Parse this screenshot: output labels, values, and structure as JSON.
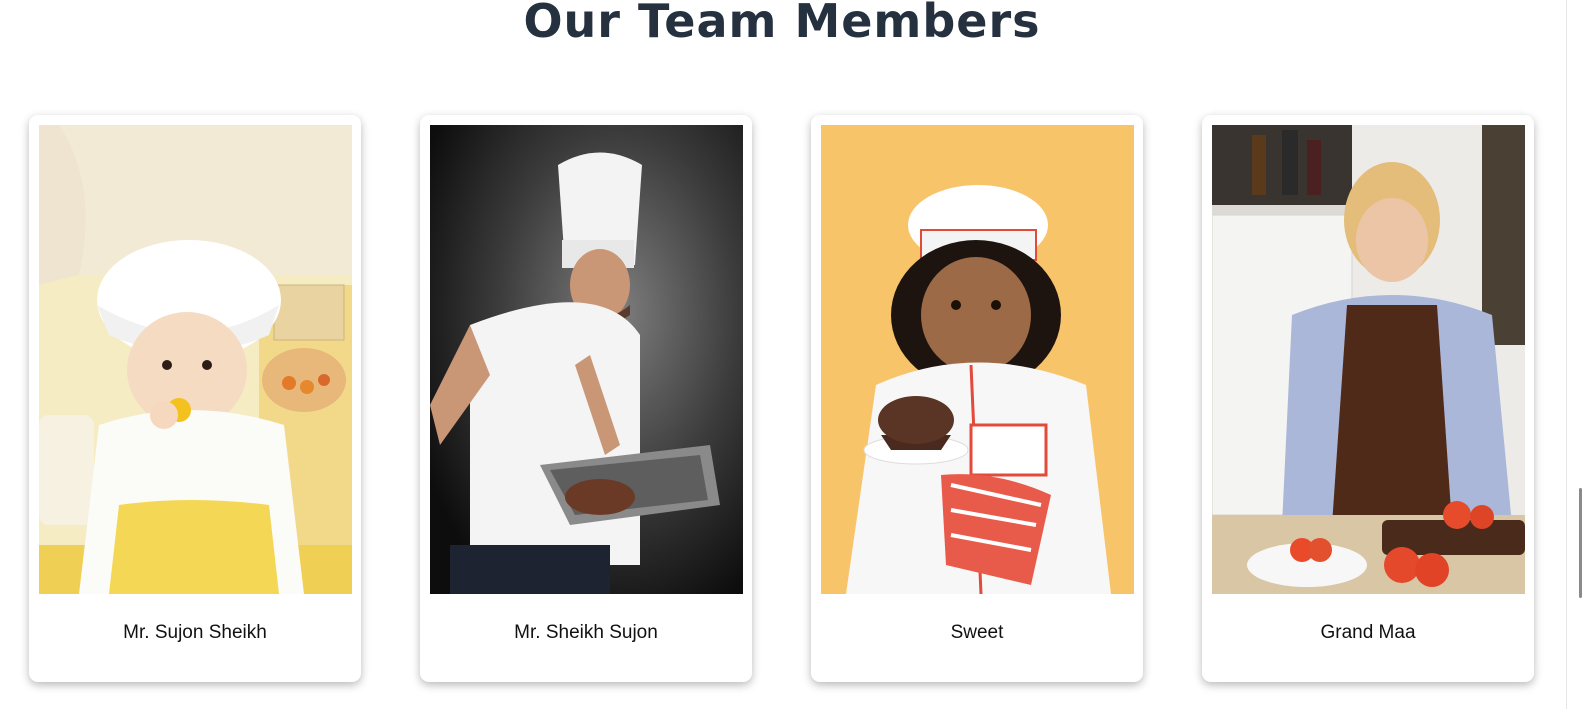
{
  "section": {
    "title": "Our Team Members"
  },
  "team": [
    {
      "name": "Mr. Sujon Sheikh",
      "photo_subject": "toddler in chef hat eating a yellow pepper"
    },
    {
      "name": "Mr. Sheikh Sujon",
      "photo_subject": "chef carving roast meat in a tray"
    },
    {
      "name": "Sweet",
      "photo_subject": "girl in chef outfit holding a chocolate muffin"
    },
    {
      "name": "Grand Maa",
      "photo_subject": "woman in apron slicing tomatoes"
    }
  ],
  "colors": {
    "title": "#263140",
    "card_background": "#ffffff",
    "name_text": "#111111"
  }
}
